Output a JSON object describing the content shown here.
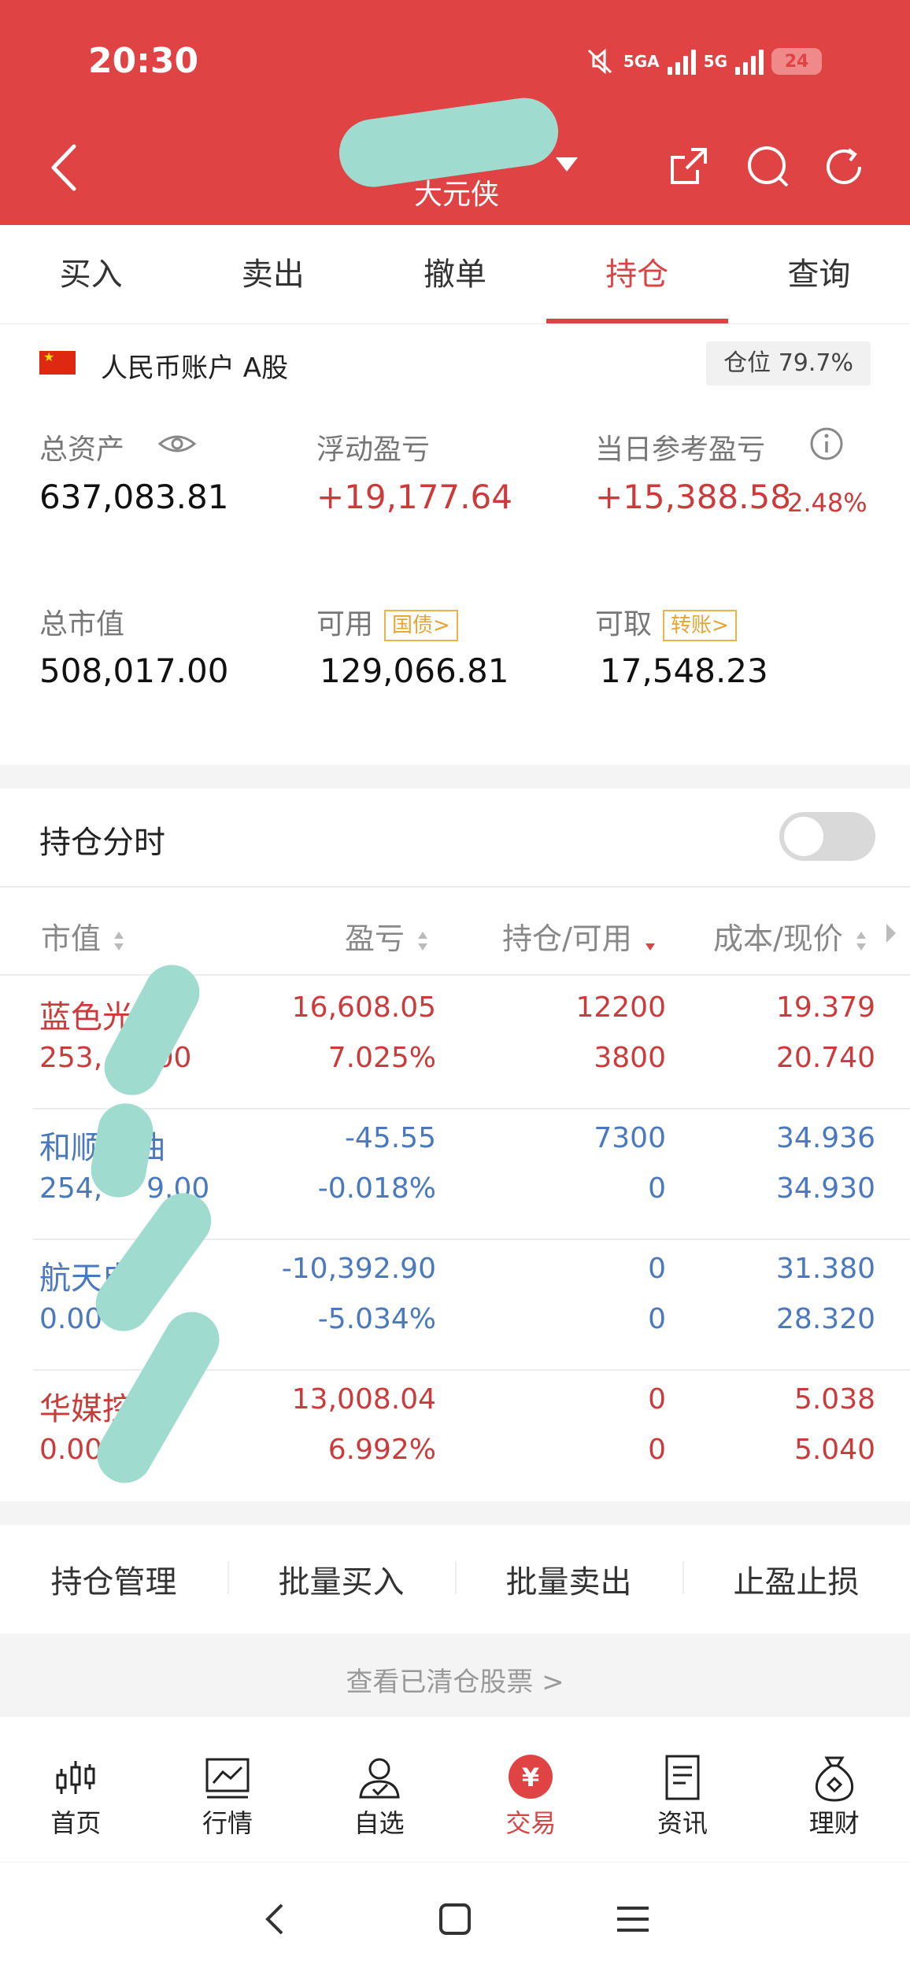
{
  "status_bar": {
    "time": "20:30",
    "network1": "5GA",
    "network2": "5G",
    "battery": "24"
  },
  "header": {
    "title": "",
    "subtitle": "大元侠"
  },
  "tabs": [
    {
      "label": "买入"
    },
    {
      "label": "卖出"
    },
    {
      "label": "撤单"
    },
    {
      "label": "持仓",
      "active": true
    },
    {
      "label": "查询"
    }
  ],
  "account": {
    "label": "人民币账户 A股",
    "position_ratio": "仓位 79.7%",
    "total_assets_label": "总资产",
    "total_assets": "637,083.81",
    "floating_pl_label": "浮动盈亏",
    "floating_pl": "+19,177.64",
    "daily_pl_label": "当日参考盈亏",
    "daily_pl": "+15,388.58",
    "daily_pl_pct": "2.48%",
    "market_value_label": "总市值",
    "market_value": "508,017.00",
    "available_label": "可用",
    "available": "129,066.81",
    "available_tag": "国债>",
    "withdrawable_label": "可取",
    "withdrawable": "17,548.23",
    "withdrawable_tag": "转账>"
  },
  "holdings": {
    "section_title": "持仓分时",
    "columns": [
      "市值",
      "盈亏",
      "持仓/可用",
      "成本/现价"
    ],
    "rows": [
      {
        "name": "蓝色光标",
        "mv": "253,",
        "mv_tail": ".00",
        "pl": "16,608.05",
        "pl_pct": "7.025%",
        "qty": "12200",
        "avail": "3800",
        "cost": "19.379",
        "price": "20.740",
        "color": "red"
      },
      {
        "name": "和顺石油",
        "mv": "254,",
        "mv_tail": "9.00",
        "pl": "-45.55",
        "pl_pct": "-0.018%",
        "qty": "7300",
        "avail": "0",
        "cost": "34.936",
        "price": "34.930",
        "color": "blue"
      },
      {
        "name": "航天电子",
        "mv": "0.00",
        "mv_tail": "",
        "pl": "-10,392.90",
        "pl_pct": "-5.034%",
        "qty": "0",
        "avail": "0",
        "cost": "31.380",
        "price": "28.320",
        "color": "blue"
      },
      {
        "name": "华媒控股",
        "mv": "0.00",
        "mv_tail": "",
        "pl": "13,008.04",
        "pl_pct": "6.992%",
        "qty": "0",
        "avail": "0",
        "cost": "5.038",
        "price": "5.040",
        "color": "red"
      }
    ]
  },
  "actions": [
    "持仓管理",
    "批量买入",
    "批量卖出",
    "止盈止损"
  ],
  "cleared_link": "查看已清仓股票 >",
  "bottom_nav": [
    {
      "label": "首页",
      "icon": "candlestick-icon"
    },
    {
      "label": "行情",
      "icon": "chart-icon"
    },
    {
      "label": "自选",
      "icon": "person-icon"
    },
    {
      "label": "交易",
      "icon": "yuan-icon",
      "active": true
    },
    {
      "label": "资讯",
      "icon": "document-icon"
    },
    {
      "label": "理财",
      "icon": "moneybag-icon"
    }
  ],
  "colors": {
    "brand_red": "#e04343",
    "gain": "#cc3b3b",
    "loss": "#4a79bd"
  }
}
